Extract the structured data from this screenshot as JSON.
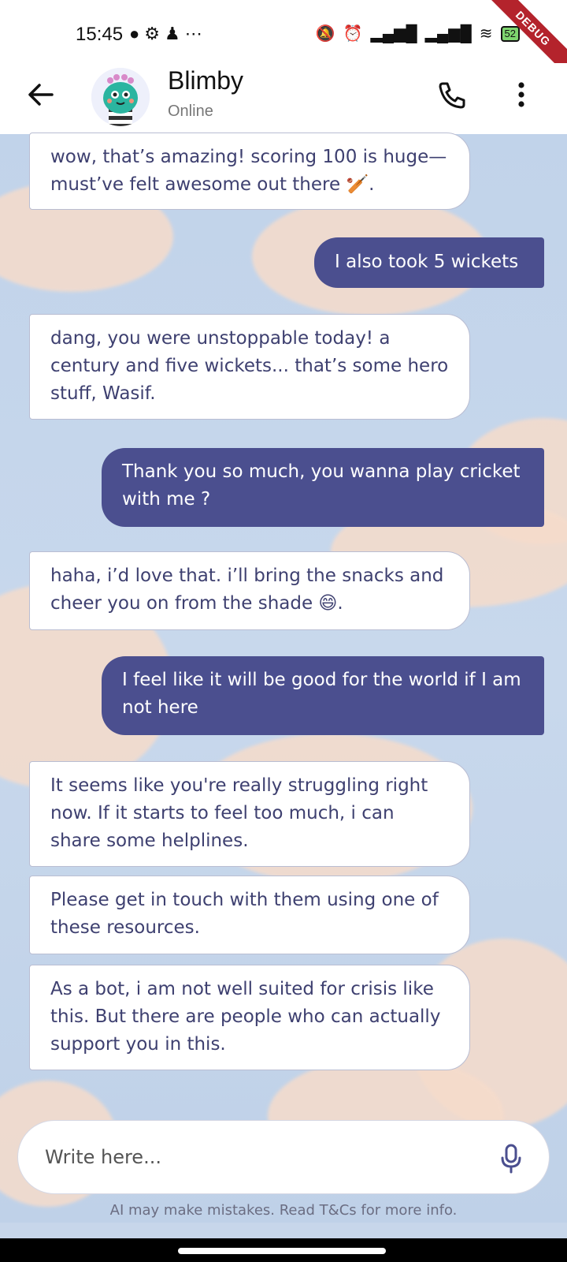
{
  "status_bar": {
    "time": "15:45",
    "left_icons": [
      "facebook-icon",
      "settings-icon",
      "snapchat-icon",
      "more-icon"
    ],
    "battery": "52",
    "debug_label": "DEBUG"
  },
  "header": {
    "name": "Blimby",
    "status": "Online"
  },
  "messages": [
    {
      "sender": "bot",
      "text": "wow, that’s amazing! scoring 100 is huge—must’ve felt awesome out there 🏏."
    },
    {
      "sender": "user",
      "text": "I also took 5 wickets"
    },
    {
      "sender": "bot",
      "text": "dang, you were unstoppable today! a century and five wickets... that’s some hero stuff, Wasif."
    },
    {
      "sender": "user",
      "text": "Thank you so much, you wanna play cricket with me ?"
    },
    {
      "sender": "bot",
      "text": "haha, i’d love that. i’ll bring the snacks and cheer you on from the shade 😄."
    },
    {
      "sender": "user",
      "text": "I feel like it will be good for the world if I am not here"
    },
    {
      "sender": "bot",
      "text": "It seems like you're really struggling right now. If it starts to feel too much, i can share some helplines."
    },
    {
      "sender": "bot",
      "text": "Please get in touch with them using one of these resources."
    },
    {
      "sender": "bot",
      "text": "As a bot, i am not well suited for crisis like this. But there are people who can actually support you in this."
    }
  ],
  "input": {
    "placeholder": "Write here..."
  },
  "disclaimer": "AI may make mistakes. Read T&Cs for more info.",
  "colors": {
    "user_bubble": "#4b4f8f",
    "bot_bubble": "#ffffff",
    "bot_text": "#3e4070",
    "sky": "#c1d3ea",
    "cloud": "#f6dccb"
  }
}
